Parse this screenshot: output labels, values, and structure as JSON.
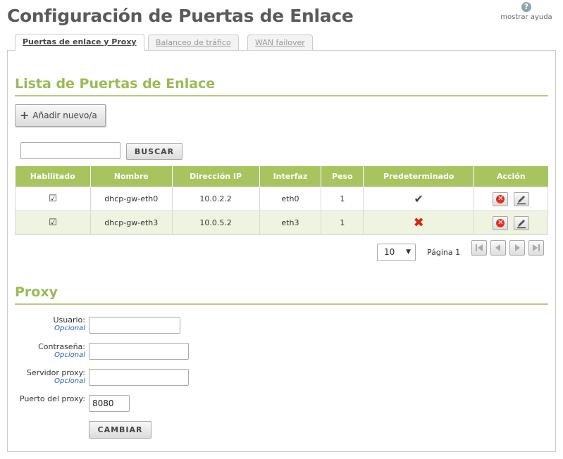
{
  "page": {
    "title": "Configuración de Puertas de Enlace",
    "help_label": "mostrar ayuda"
  },
  "tabs": [
    {
      "label": "Puertas de enlace y Proxy",
      "active": true
    },
    {
      "label": "Balanceo de tráfico",
      "active": false
    },
    {
      "label": "WAN failover",
      "active": false
    }
  ],
  "gateways": {
    "section_title": "Lista de Puertas de Enlace",
    "add_label": "Añadir nuevo/a",
    "search_value": "",
    "search_button": "BUSCAR",
    "columns": [
      "Habilitado",
      "Nombre",
      "Dirección IP",
      "Interfaz",
      "Peso",
      "Predeterminado",
      "Acción"
    ],
    "rows": [
      {
        "enabled": true,
        "name": "dhcp-gw-eth0",
        "ip": "10.0.2.2",
        "iface": "eth0",
        "weight": "1",
        "default": true
      },
      {
        "enabled": true,
        "name": "dhcp-gw-eth3",
        "ip": "10.0.5.2",
        "iface": "eth3",
        "weight": "1",
        "default": false
      }
    ],
    "pager": {
      "page_size": "10",
      "page_label": "Página 1"
    }
  },
  "proxy": {
    "section_title": "Proxy",
    "user_label": "Usuario:",
    "user_optional": "Opcional",
    "user_value": "",
    "password_label": "Contraseña:",
    "password_optional": "Opcional",
    "password_value": "",
    "server_label": "Servidor proxy:",
    "server_optional": "Opcional",
    "server_value": "",
    "port_label": "Puerto del proxy:",
    "port_value": "8080",
    "submit_label": "CAMBIAR"
  },
  "colors": {
    "accent_green": "#a8c45e",
    "title_green": "#9cba56",
    "delete_red": "#e03020",
    "optional_blue": "#2563a8"
  },
  "icons": {
    "help": "question-circle-icon",
    "add": "plus-icon",
    "delete": "delete-circle-icon",
    "edit": "pencil-icon",
    "first": "first-page-icon",
    "prev": "previous-page-icon",
    "next": "next-page-icon",
    "last": "last-page-icon"
  }
}
